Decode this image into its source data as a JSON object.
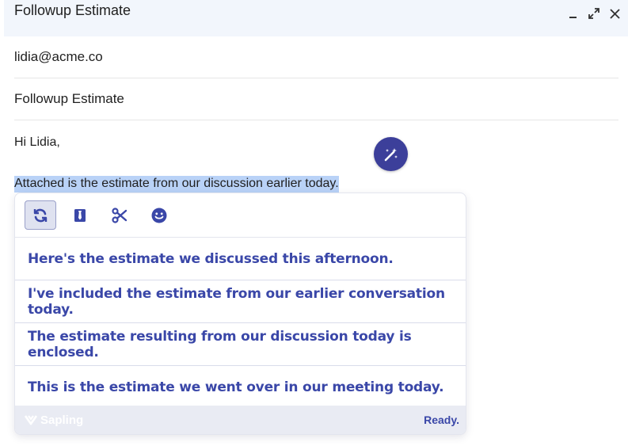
{
  "compose": {
    "title": "Followup Estimate",
    "to": "lidia@acme.co",
    "subject": "Followup Estimate",
    "body": {
      "greeting": "Hi Lidia,",
      "selected_text": "Attached is the estimate from our discussion earlier today."
    },
    "window_controls": [
      "minimize-icon",
      "expand-icon",
      "close-icon"
    ]
  },
  "assistant": {
    "tools": [
      {
        "icon": "rephrase-icon",
        "active": true
      },
      {
        "icon": "formal-icon",
        "active": false
      },
      {
        "icon": "shorten-icon",
        "active": false
      },
      {
        "icon": "emoji-icon",
        "active": false
      }
    ],
    "suggestions": [
      "Here's the estimate we discussed this afternoon.",
      "I've included the estimate from our earlier conversation today.",
      "The estimate resulting from our discussion today is enclosed.",
      "This is the estimate we went over in our meeting today."
    ],
    "brand": "Sapling",
    "status": "Ready.",
    "colors": {
      "accent": "#3a47a8",
      "button": "#3c3f9a",
      "footer_bg": "#e9ebf3",
      "selection": "#b9d2f7"
    }
  }
}
